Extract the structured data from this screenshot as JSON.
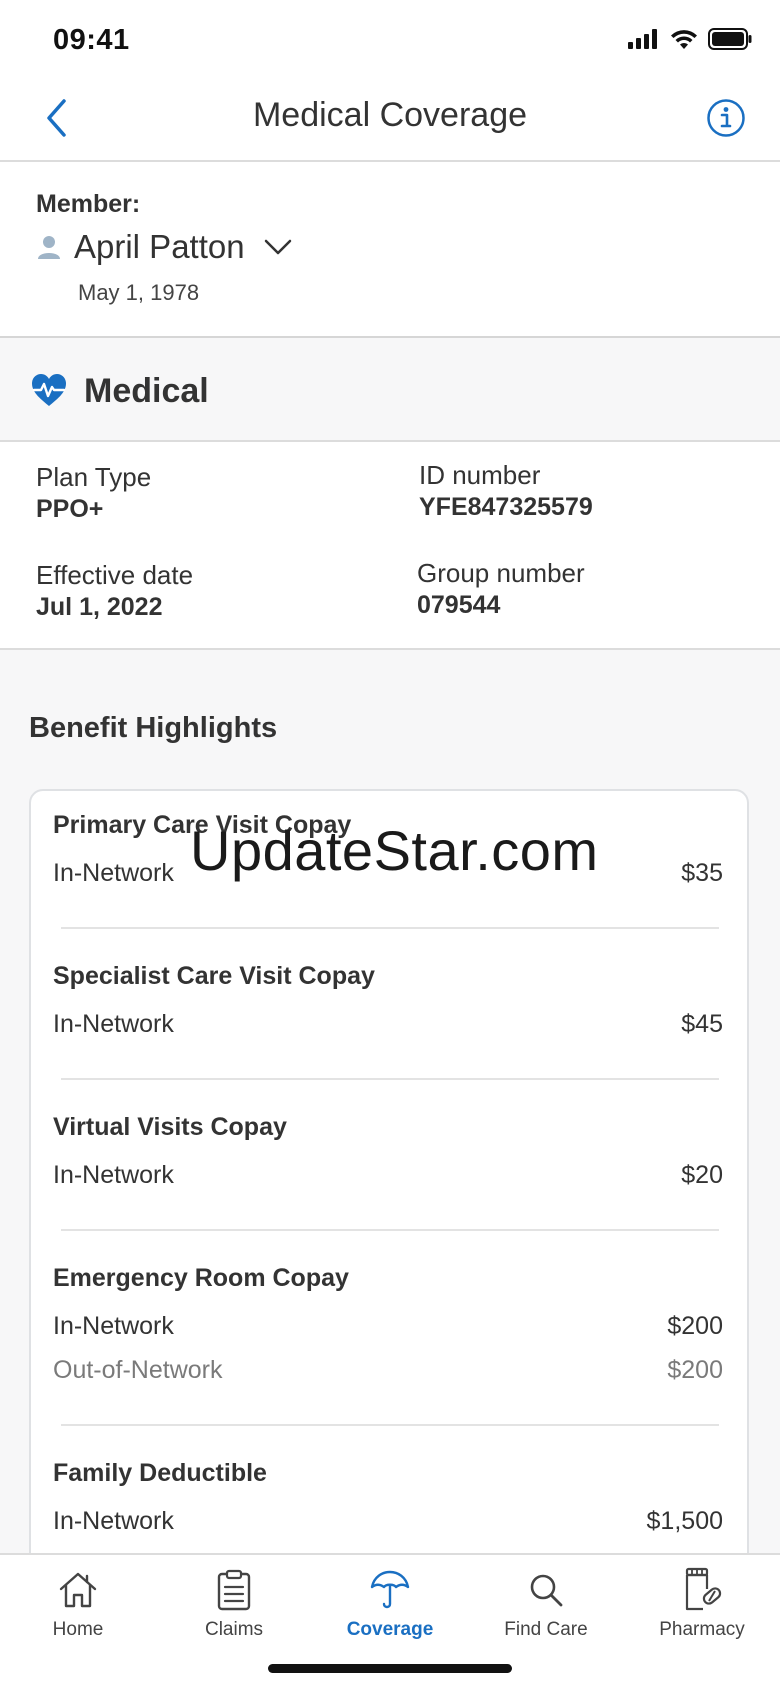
{
  "status_bar": {
    "time": "09:41"
  },
  "header": {
    "title": "Medical Coverage"
  },
  "member": {
    "label": "Member:",
    "name": "April Patton",
    "dob": "May 1, 1978"
  },
  "section": {
    "title": "Medical"
  },
  "plan": {
    "plan_type_label": "Plan Type",
    "plan_type": "PPO+",
    "id_label": "ID number",
    "id_value": "YFE847325579",
    "effective_label": "Effective date",
    "effective_value": "Jul 1, 2022",
    "group_label": "Group number",
    "group_value": "079544"
  },
  "benefits": {
    "title": "Benefit Highlights",
    "items": [
      {
        "title": "Primary Care Visit Copay",
        "rows": [
          {
            "label": "In-Network",
            "value": "$35"
          }
        ]
      },
      {
        "title": "Specialist Care Visit Copay",
        "rows": [
          {
            "label": "In-Network",
            "value": "$45"
          }
        ]
      },
      {
        "title": "Virtual Visits Copay",
        "rows": [
          {
            "label": "In-Network",
            "value": "$20"
          }
        ]
      },
      {
        "title": "Emergency Room Copay",
        "rows": [
          {
            "label": "In-Network",
            "value": "$200"
          },
          {
            "label": "Out-of-Network",
            "value": "$200"
          }
        ]
      },
      {
        "title": "Family Deductible",
        "rows": [
          {
            "label": "In-Network",
            "value": "$1,500"
          }
        ]
      }
    ]
  },
  "watermark": "UpdateStar.com",
  "tabs": [
    {
      "label": "Home",
      "icon": "home-icon"
    },
    {
      "label": "Claims",
      "icon": "clipboard-icon"
    },
    {
      "label": "Coverage",
      "icon": "umbrella-icon",
      "active": true
    },
    {
      "label": "Find Care",
      "icon": "search-icon"
    },
    {
      "label": "Pharmacy",
      "icon": "pharmacy-icon"
    }
  ],
  "colors": {
    "accent": "#1a6fc2",
    "text": "#333333",
    "muted": "#7a7a7a",
    "section_bg": "#f7f7f8"
  }
}
